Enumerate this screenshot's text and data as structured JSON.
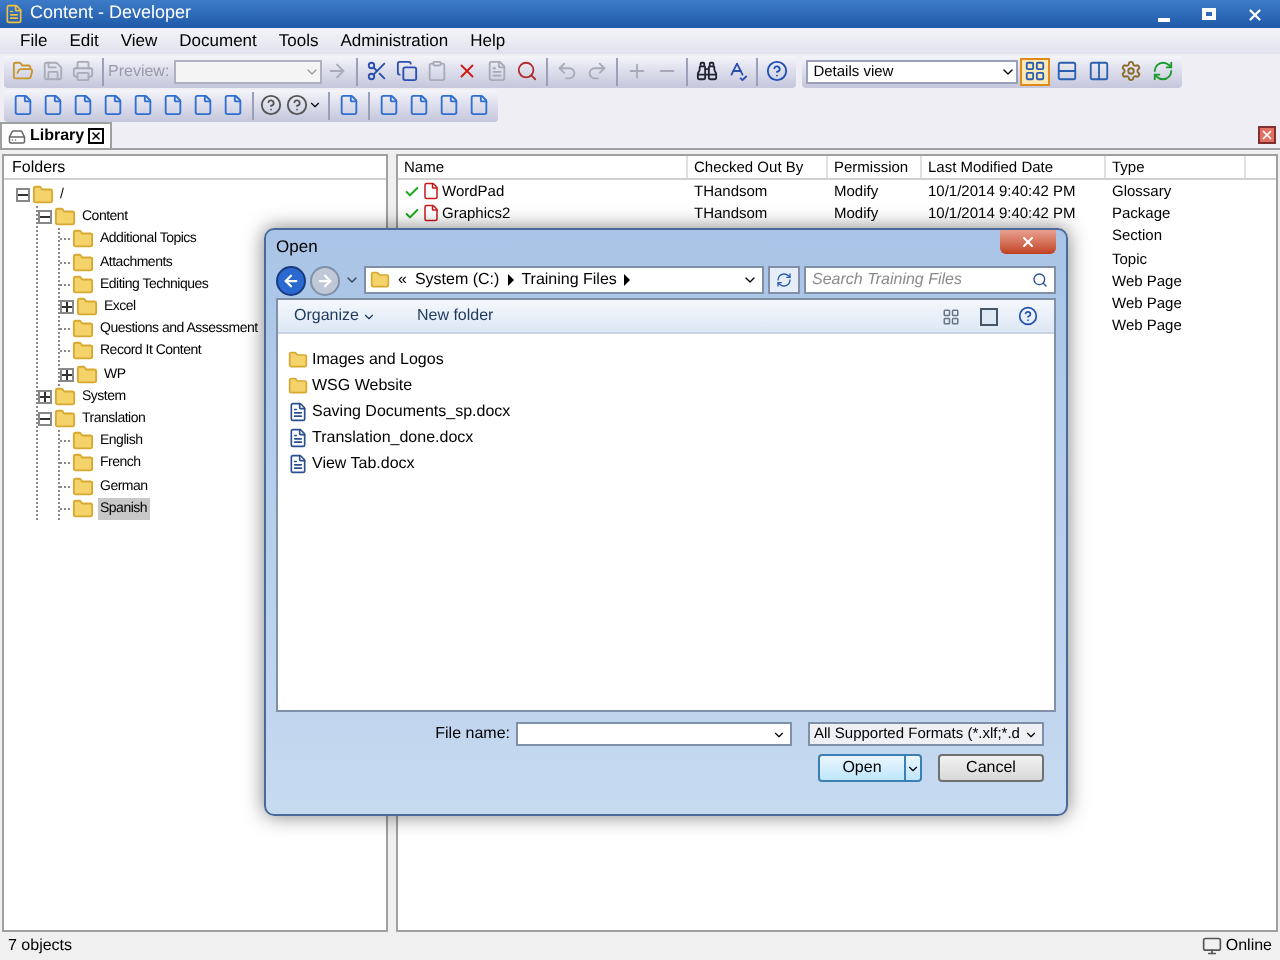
{
  "window": {
    "title": "Content - Developer"
  },
  "menu": [
    "File",
    "Edit",
    "View",
    "Document",
    "Tools",
    "Administration",
    "Help"
  ],
  "toolbar_1": [
    {
      "kind": "open",
      "disabled": false
    },
    {
      "kind": "save",
      "disabled": true
    },
    {
      "kind": "print",
      "disabled": true
    },
    {
      "kind": "sep"
    },
    {
      "kind": "preview",
      "label": "Preview:",
      "disabled": true
    },
    {
      "kind": "go",
      "disabled": true
    },
    {
      "kind": "sep"
    },
    {
      "kind": "cut",
      "disabled": false
    },
    {
      "kind": "copy",
      "disabled": false
    },
    {
      "kind": "paste",
      "disabled": true
    },
    {
      "kind": "delete",
      "disabled": false
    },
    {
      "kind": "rename",
      "disabled": true
    },
    {
      "kind": "find",
      "disabled": false
    },
    {
      "kind": "sep"
    },
    {
      "kind": "undo",
      "disabled": true
    },
    {
      "kind": "redo",
      "disabled": true
    },
    {
      "kind": "sep"
    },
    {
      "kind": "expand",
      "disabled": true
    },
    {
      "kind": "collapse",
      "disabled": true
    },
    {
      "kind": "sep"
    },
    {
      "kind": "binoculars",
      "disabled": false
    },
    {
      "kind": "spell",
      "disabled": false
    },
    {
      "kind": "sep"
    },
    {
      "kind": "help",
      "disabled": false
    }
  ],
  "view_select": "Details view",
  "view_buttons": [
    {
      "kind": "details",
      "selected": true
    },
    {
      "kind": "split-h",
      "selected": false
    },
    {
      "kind": "split-v",
      "selected": false
    },
    {
      "kind": "properties",
      "selected": false
    },
    {
      "kind": "refresh",
      "selected": false
    }
  ],
  "toolbar_2": [
    {
      "kind": "doc"
    },
    {
      "kind": "doc"
    },
    {
      "kind": "doc"
    },
    {
      "kind": "doc"
    },
    {
      "kind": "doc"
    },
    {
      "kind": "doc"
    },
    {
      "kind": "doc"
    },
    {
      "kind": "doc"
    },
    {
      "kind": "sep"
    },
    {
      "kind": "question"
    },
    {
      "kind": "question-menu"
    },
    {
      "kind": "sep"
    },
    {
      "kind": "doc"
    },
    {
      "kind": "sep"
    },
    {
      "kind": "doc"
    },
    {
      "kind": "doc"
    },
    {
      "kind": "doc"
    },
    {
      "kind": "doc"
    }
  ],
  "tabs": [
    {
      "label": "Library",
      "selected": true
    }
  ],
  "folders": {
    "heading": "Folders",
    "tree": [
      {
        "label": "/",
        "expanded": true,
        "selected": false,
        "children": [
          {
            "label": "Content",
            "expanded": true,
            "selected": false,
            "children": [
              {
                "label": "Additional Topics",
                "selected": false
              },
              {
                "label": "Attachments",
                "selected": false
              },
              {
                "label": "Editing Techniques",
                "selected": false
              },
              {
                "label": "Excel",
                "expanded": false,
                "selected": false
              },
              {
                "label": "Questions and Assessment",
                "selected": false
              },
              {
                "label": "Record It Content",
                "selected": false
              },
              {
                "label": "WP",
                "expanded": false,
                "selected": false
              }
            ]
          },
          {
            "label": "System",
            "expanded": false,
            "selected": false
          },
          {
            "label": "Translation",
            "expanded": true,
            "selected": false,
            "children": [
              {
                "label": "English",
                "selected": false
              },
              {
                "label": "French",
                "selected": false
              },
              {
                "label": "German",
                "selected": false
              },
              {
                "label": "Spanish",
                "selected": true
              }
            ]
          }
        ]
      }
    ]
  },
  "list": {
    "columns": [
      "Name",
      "Checked Out By",
      "Permission",
      "Last Modified Date",
      "Type"
    ],
    "rows": [
      {
        "name": "WordPad",
        "checked_out_by": "THandsom",
        "permission": "Modify",
        "modified": "10/1/2014 9:40:42 PM",
        "type": "Glossary"
      },
      {
        "name": "Graphics2",
        "checked_out_by": "THandsom",
        "permission": "Modify",
        "modified": "10/1/2014 9:40:42 PM",
        "type": "Package"
      },
      {
        "type": "Section"
      },
      {
        "type": "Topic"
      },
      {
        "type": "Web Page"
      },
      {
        "type": "Web Page"
      },
      {
        "type": "Web Page"
      }
    ]
  },
  "dialog": {
    "title": "Open",
    "breadcrumb": [
      "«",
      "System (C:)",
      "Training Files"
    ],
    "search_placeholder": "Search Training Files",
    "organize": "Organize",
    "new_folder": "New folder",
    "files": [
      {
        "kind": "folder",
        "name": "Images and Logos"
      },
      {
        "kind": "folder",
        "name": "WSG Website"
      },
      {
        "kind": "doc",
        "name": "Saving Documents_sp.docx"
      },
      {
        "kind": "doc",
        "name": "Translation_done.docx"
      },
      {
        "kind": "doc",
        "name": "View Tab.docx"
      }
    ],
    "file_name_label": "File name:",
    "filter": "All Supported Formats (*.xlf;*.d",
    "open": "Open",
    "cancel": "Cancel"
  },
  "status_bar": {
    "count": "7 objects",
    "connection": "Online"
  }
}
